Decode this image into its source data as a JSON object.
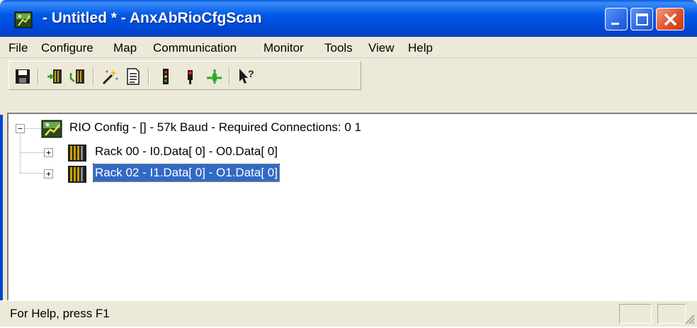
{
  "window": {
    "title": " - Untitled * - AnxAbRioCfgScan"
  },
  "menu": {
    "items": [
      "File",
      "Configure",
      "Map",
      "Communication",
      "Monitor",
      "Tools",
      "View",
      "Help"
    ]
  },
  "toolbar": {
    "buttons": [
      "save-icon",
      "rack-load-icon",
      "rack-save-icon",
      "wizard-icon",
      "document-icon",
      "traffic-light-icon",
      "run-icon",
      "connect-icon",
      "context-help-icon"
    ]
  },
  "tree": {
    "root": {
      "label": "RIO Config - [] -  57k Baud - Required Connections: 0 1",
      "expander": "−"
    },
    "children": [
      {
        "label": "Rack 00 - I0.Data[  0] - O0.Data[  0]",
        "expander": "+",
        "selected": false
      },
      {
        "label": "Rack 02 - I1.Data[  0] - O1.Data[  0]",
        "expander": "+",
        "selected": true
      }
    ]
  },
  "statusbar": {
    "text": "For Help, press F1"
  },
  "colors": {
    "titlebar": "#0058e6",
    "selection": "#316ac5",
    "close_button": "#e0542c"
  }
}
